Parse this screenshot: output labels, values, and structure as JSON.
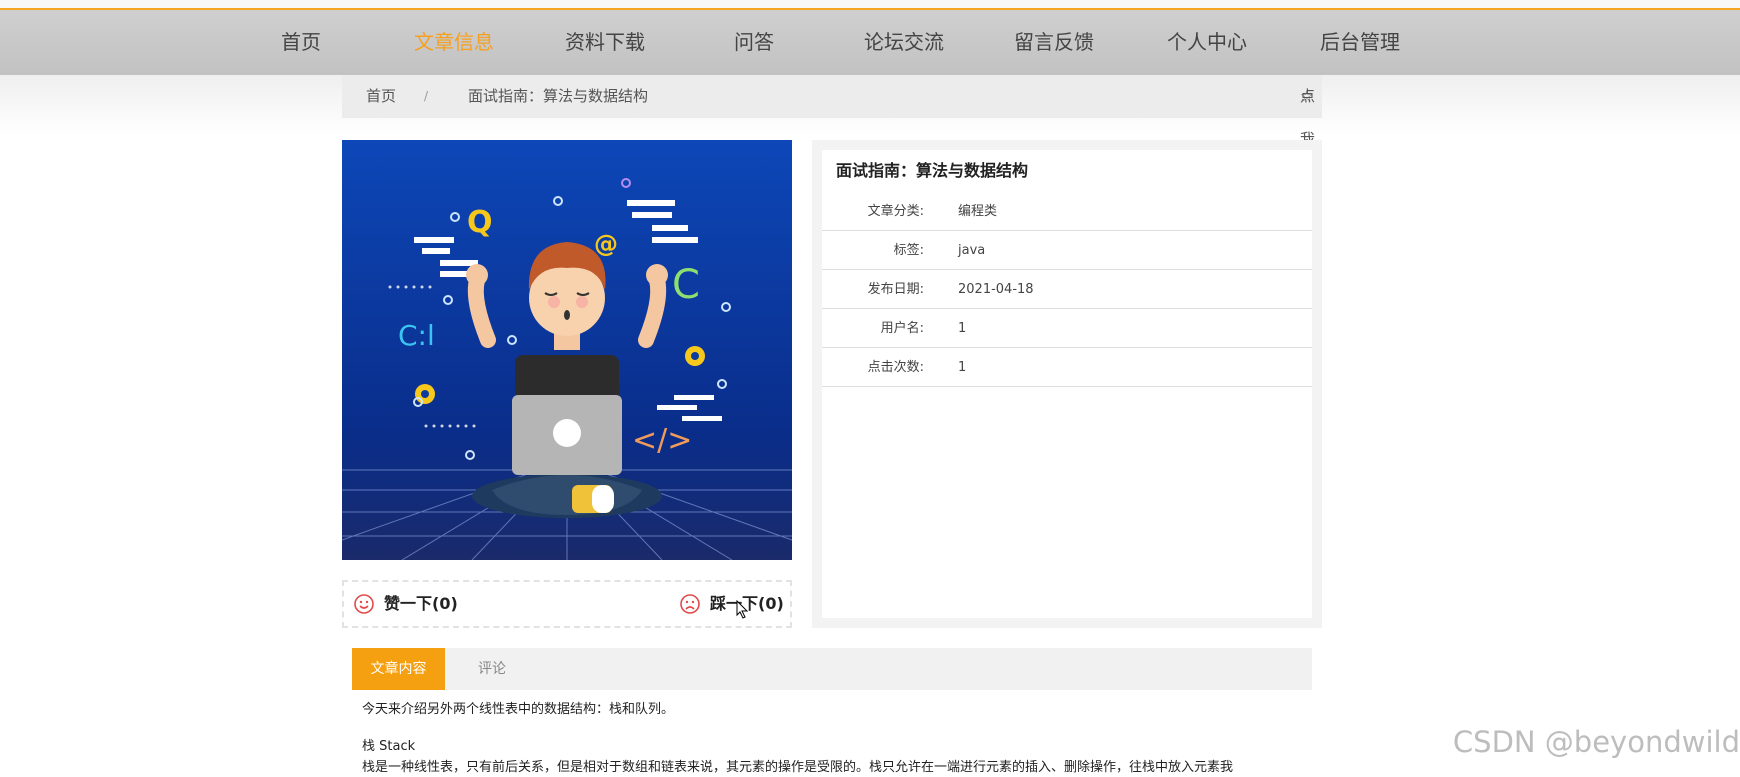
{
  "nav": {
    "items": [
      "首页",
      "文章信息",
      "资料下载",
      "问答",
      "论坛交流",
      "留言反馈",
      "个人中心",
      "后台管理"
    ],
    "active": "文章信息",
    "active_color": "#f5a020"
  },
  "breadcrumb": {
    "home": "首页",
    "separator": "/",
    "current": "面试指南：算法与数据结构",
    "favorite_label": "点我收藏",
    "favorite_icon": "star-outline-icon"
  },
  "cover": {
    "icons": [
      "programmer-meditating-illustration",
      "laptop-icon",
      "gear-icon",
      "code-tag-icon"
    ]
  },
  "vote": {
    "like_label": "赞一下(0)",
    "like_icon": "smile-face-icon",
    "dislike_label": "踩一下(0)",
    "dislike_icon": "sad-face-icon"
  },
  "info": {
    "title": "面试指南：算法与数据结构",
    "rows": [
      {
        "label": "文章分类:",
        "value": "编程类"
      },
      {
        "label": "标签:",
        "value": "java"
      },
      {
        "label": "发布日期:",
        "value": "2021-04-18"
      },
      {
        "label": "用户名:",
        "value": "1"
      },
      {
        "label": "点击次数:",
        "value": "1"
      }
    ]
  },
  "tabs": {
    "content_label": "文章内容",
    "comments_label": "评论"
  },
  "content": {
    "intro": "今天来介绍另外两个线性表中的数据结构：栈和队列。",
    "heading": "栈 Stack",
    "para": "栈是一种线性表，只有前后关系，但是相对于数组和链表来说，其元素的操作是受限的。栈只允许在一端进行元素的插入、删除操作，往栈中放入元素我"
  },
  "watermark": "CSDN @beyondwild",
  "colors": {
    "accent": "#f5a020",
    "nav_bg": "#c8c8c8",
    "tab_active": "#f5a010"
  }
}
